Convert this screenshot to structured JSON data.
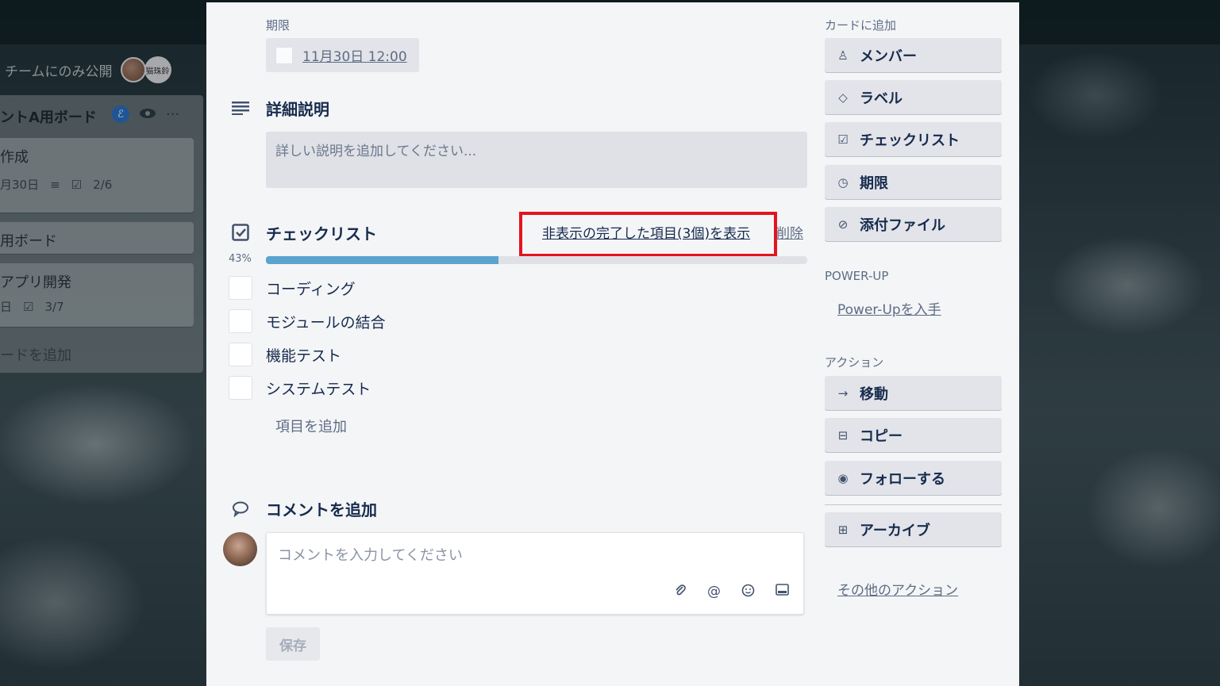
{
  "board": {
    "visibility": "チームにのみ公開",
    "member_label": "猫珠鈴",
    "list": {
      "title": "ントA用ボード",
      "badge": "ℰ",
      "more": "···",
      "cards": [
        {
          "title": "作成",
          "date": "月30日",
          "checklist": "2/6"
        },
        {
          "title": "用ボード"
        },
        {
          "title": "アプリ開発",
          "date": "日",
          "checklist": "3/7"
        }
      ],
      "add_card": "ードを追加"
    }
  },
  "card": {
    "due": {
      "label": "期限",
      "value": "11月30日 12:00"
    },
    "description": {
      "title": "詳細説明",
      "placeholder": "詳しい説明を追加してください..."
    },
    "checklist": {
      "title": "チェックリスト",
      "show_completed": "非表示の完了した項目(3個)を表示",
      "delete": "削除",
      "percent_label": "43%",
      "progress": 0.43,
      "items": [
        {
          "label": "コーディング",
          "checked": false
        },
        {
          "label": "モジュールの結合",
          "checked": false
        },
        {
          "label": "機能テスト",
          "checked": false
        },
        {
          "label": "システムテスト",
          "checked": false
        }
      ],
      "add_item": "項目を追加"
    },
    "comment": {
      "title": "コメントを追加",
      "placeholder": "コメントを入力してください",
      "save": "保存"
    }
  },
  "sidebar": {
    "add_to_card": "カードに追加",
    "add_buttons": [
      {
        "label": "メンバー",
        "icon": "person-icon"
      },
      {
        "label": "ラベル",
        "icon": "tag-icon"
      },
      {
        "label": "チェックリスト",
        "icon": "checkbox-icon"
      },
      {
        "label": "期限",
        "icon": "clock-icon"
      },
      {
        "label": "添付ファイル",
        "icon": "paperclip-icon"
      }
    ],
    "powerup_heading": "POWER-UP",
    "powerup_link": "Power-Upを入手",
    "actions_heading": "アクション",
    "action_buttons": [
      {
        "label": "移動",
        "icon": "arrow-right-icon"
      },
      {
        "label": "コピー",
        "icon": "copy-icon"
      },
      {
        "label": "フォローする",
        "icon": "eye-icon"
      },
      {
        "label": "アーカイブ",
        "icon": "archive-icon"
      }
    ],
    "more_actions": "その他のアクション"
  },
  "colors": {
    "highlight": "#e3141f",
    "progress": "#5ba4cf",
    "modal_bg": "#f4f5f7"
  }
}
